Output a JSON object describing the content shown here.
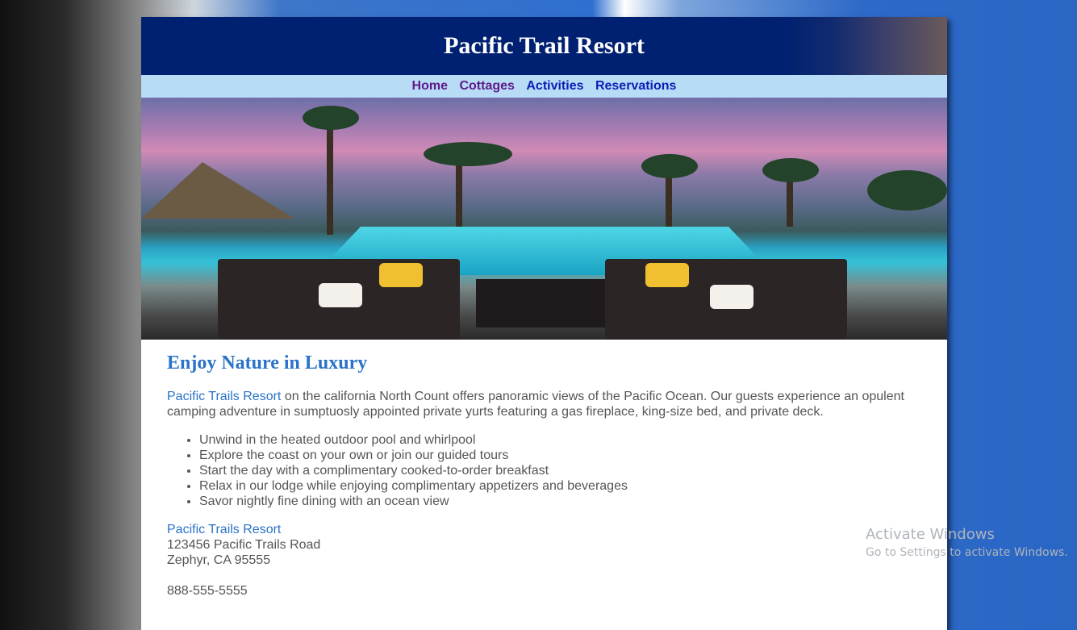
{
  "header": {
    "title": "Pacific Trail Resort"
  },
  "nav": [
    {
      "label": "Home",
      "state": "visited"
    },
    {
      "label": "Cottages",
      "state": "visited"
    },
    {
      "label": "Activities",
      "state": "link"
    },
    {
      "label": "Reservations",
      "state": "link"
    }
  ],
  "main": {
    "heading": "Enjoy Nature in Luxury",
    "intro_brand": "Pacific Trails Resort",
    "intro_text": " on the california North Count offers panoramic views of the Pacific Ocean. Our guests experience an opulent camping adventure in sumptuosly appointed private yurts featuring a gas fireplace, king-size bed, and private deck.",
    "features": [
      "Unwind in the heated outdoor pool and whirlpool",
      "Explore the coast on your own or join our guided tours",
      "Start the day with a complimentary cooked-to-order breakfast",
      "Relax in our lodge while enjoying complimentary appetizers and beverages",
      "Savor nightly fine dining with an ocean view"
    ],
    "address": {
      "name": "Pacific Trails Resort",
      "street": "123456 Pacific Trails Road",
      "city": "Zephyr, CA 95555",
      "phone": "888-555-5555"
    }
  },
  "watermark": {
    "line1": "Activate Windows",
    "line2": "Go to Settings to activate Windows."
  },
  "colors": {
    "header_bg": "#002171",
    "nav_bg": "#b8dbf6",
    "accent": "#2a73c7"
  }
}
